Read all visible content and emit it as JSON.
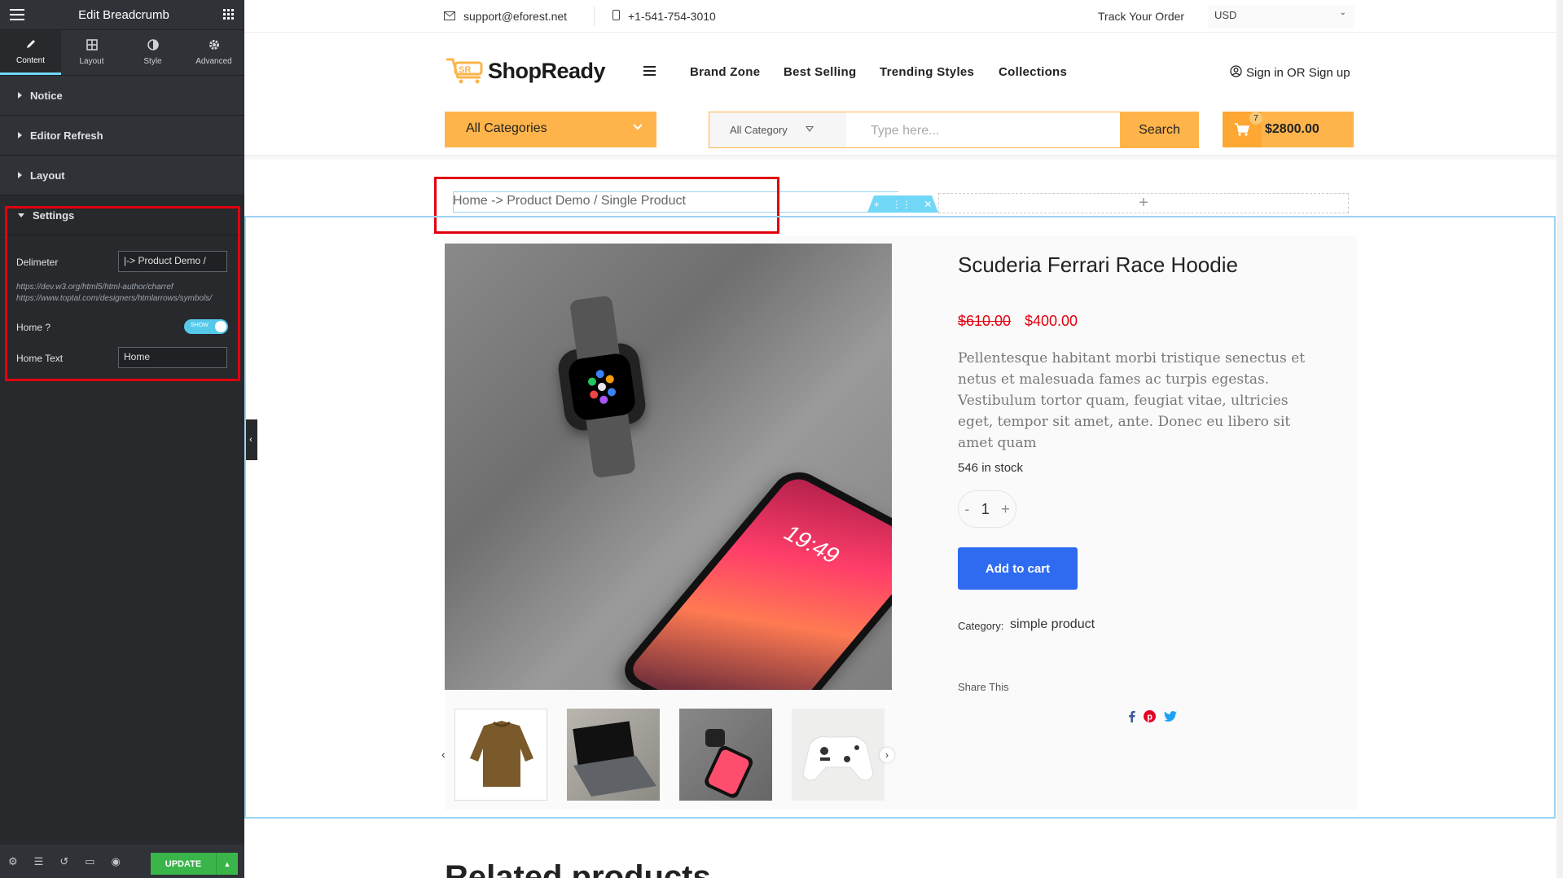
{
  "editor": {
    "title": "Edit Breadcrumb",
    "tabs": [
      {
        "label": "Content",
        "icon": "pencil-icon"
      },
      {
        "label": "Layout",
        "icon": "layout-icon"
      },
      {
        "label": "Style",
        "icon": "contrast-icon"
      },
      {
        "label": "Advanced",
        "icon": "gear-icon"
      }
    ],
    "sections": [
      "Notice",
      "Editor Refresh",
      "Layout",
      "Settings"
    ],
    "settings": {
      "delimeter_label": "Delimeter",
      "delimeter_value": "|-> Product Demo /",
      "note1": "https://dev.w3.org/html5/html-author/charref",
      "note2": "https://www.toptal.com/designers/htmlarrows/symbols/",
      "home_label": "Home ?",
      "home_toggle": "SHOW",
      "home_text_label": "Home Text",
      "home_text_value": "Home"
    },
    "update_label": "UPDATE"
  },
  "site": {
    "email": "support@eforest.net",
    "phone": "+1-541-754-3010",
    "track": "Track Your Order",
    "currency": "USD",
    "logo": "ShopReady",
    "nav": [
      "Brand Zone",
      "Best Selling",
      "Trending Styles",
      "Collections"
    ],
    "signin": "Sign in OR Sign up",
    "all_categories": "All Categories",
    "category_select": "All Category",
    "search_placeholder": "Type here...",
    "search_button": "Search",
    "cart_count": "7",
    "cart_total": "$2800.00"
  },
  "breadcrumb": "Home -> Product Demo / Single Product",
  "product": {
    "title": "Scuderia Ferrari Race Hoodie",
    "old_price": "$610.00",
    "price": "$400.00",
    "description": "Pellentesque habitant morbi tristique senectus et netus et malesuada fames ac turpis egestas. Vestibulum tortor quam, feugiat vitae, ultricies eget, tempor sit amet, ante. Donec eu libero sit amet quam",
    "stock": "546 in stock",
    "quantity": "1",
    "add_to_cart": "Add to cart",
    "category_label": "Category:",
    "category_value": "simple product",
    "share": "Share This",
    "phone_time": "19:49"
  },
  "related_heading": "Related products",
  "colors": {
    "accent": "#feb44a",
    "button_blue": "#2f6bf1",
    "price_red": "#e2000e",
    "editor_cyan": "#71d7f7"
  }
}
